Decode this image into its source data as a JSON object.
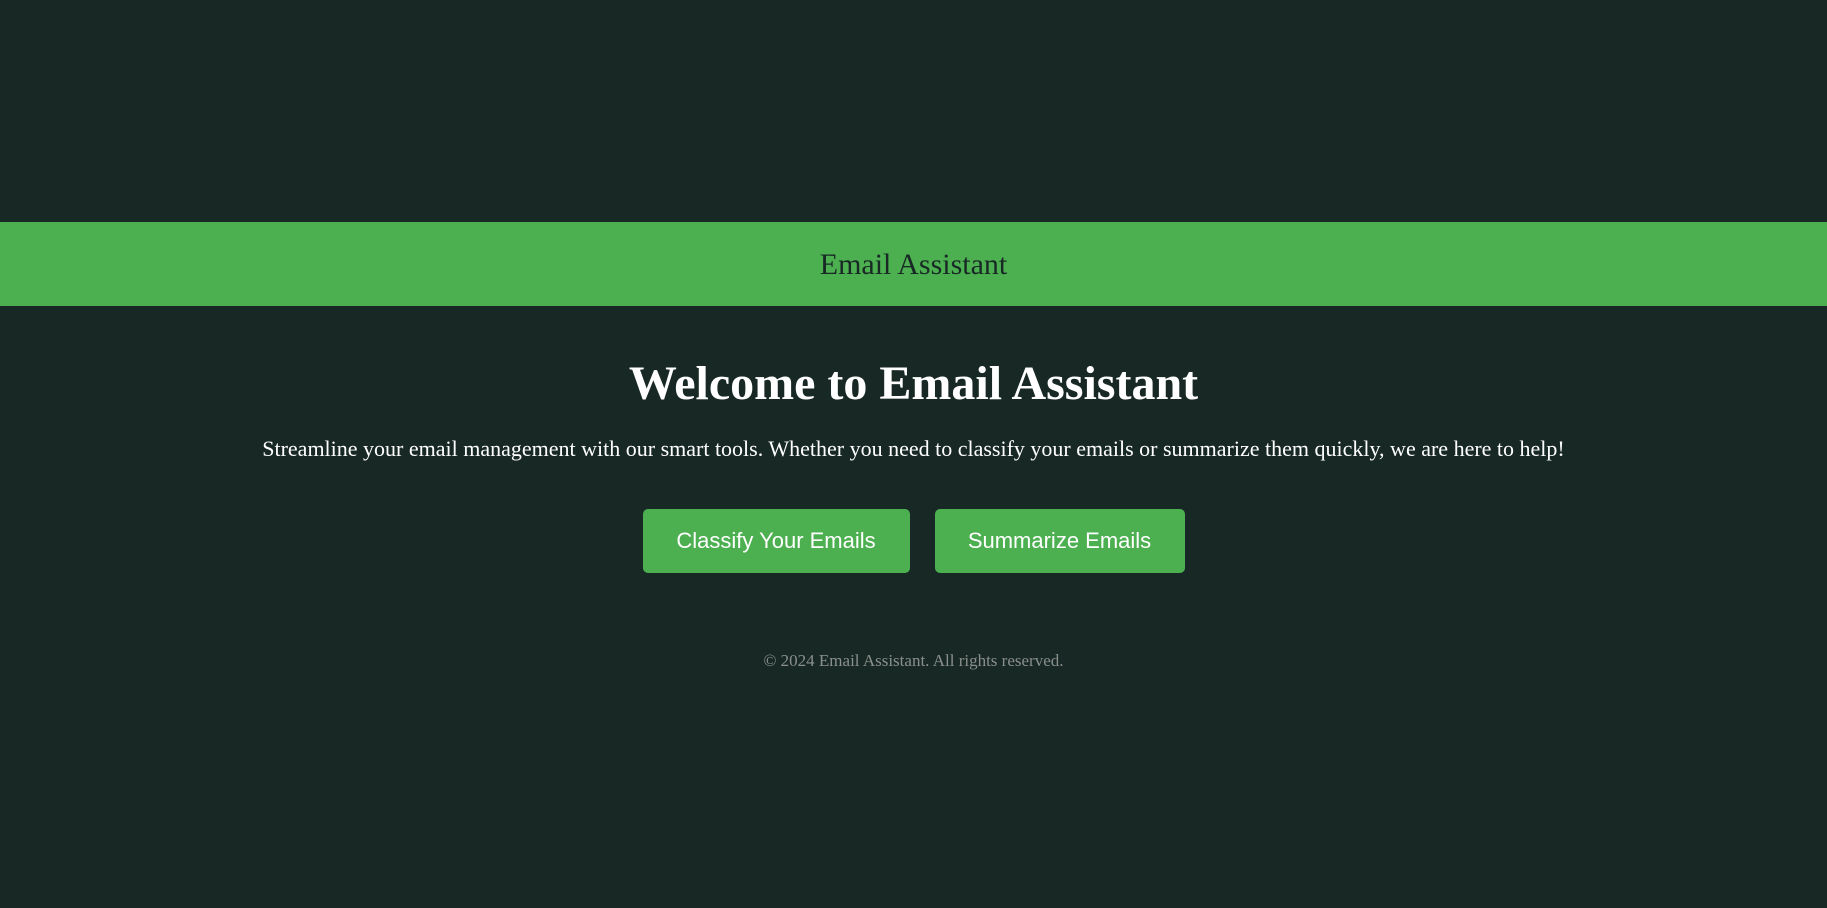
{
  "header": {
    "title": "Email Assistant"
  },
  "main": {
    "heading": "Welcome to Email Assistant",
    "tagline": "Streamline your email management with our smart tools. Whether you need to classify your emails or summarize them quickly, we are here to help!",
    "buttons": {
      "classify_label": "Classify Your Emails",
      "summarize_label": "Summarize Emails"
    }
  },
  "footer": {
    "text": "© 2024 Email Assistant. All rights reserved."
  },
  "colors": {
    "background": "#182925",
    "accent": "#4caf50",
    "text": "#ffffff",
    "muted": "#8a8f8c"
  }
}
